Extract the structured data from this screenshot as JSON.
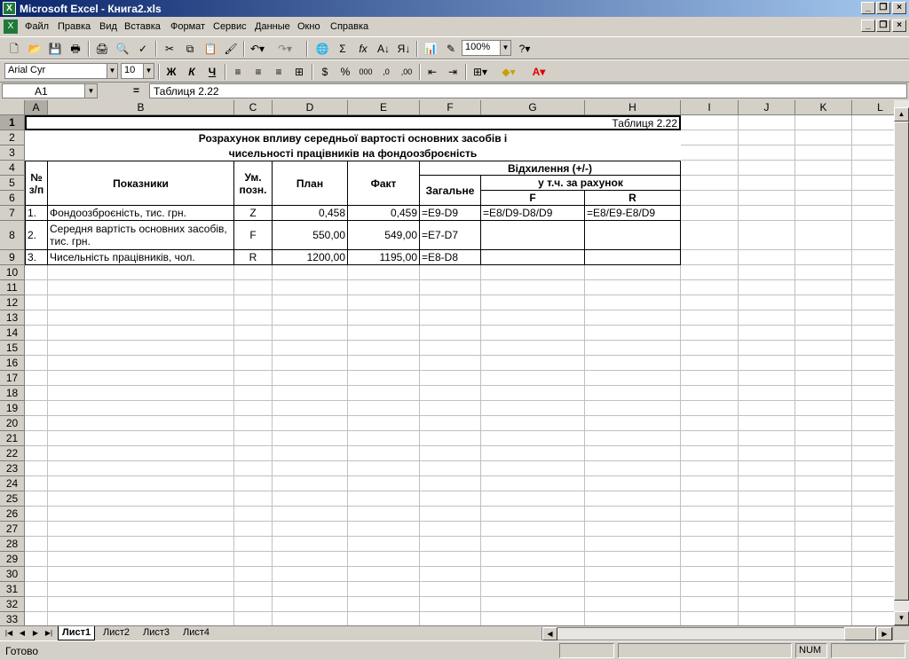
{
  "window": {
    "title": "Microsoft Excel - Книга2.xls"
  },
  "menu": [
    "Файл",
    "Правка",
    "Вид",
    "Вставка",
    "Формат",
    "Сервис",
    "Данные",
    "Окно",
    "Справка"
  ],
  "toolbar": {
    "zoom": "100%",
    "font": "Arial Cyr",
    "size": "10"
  },
  "formula_bar": {
    "cell_ref": "A1",
    "equals": "=",
    "content": "Таблиця 2.22"
  },
  "columns": [
    "A",
    "B",
    "C",
    "D",
    "E",
    "F",
    "G",
    "H",
    "I",
    "J",
    "K",
    "L"
  ],
  "rows": [
    "1",
    "2",
    "3",
    "4",
    "5",
    "6",
    "7",
    "8",
    "9",
    "10",
    "11",
    "12",
    "13",
    "14",
    "15",
    "16",
    "17",
    "18",
    "19",
    "20",
    "21",
    "22",
    "23",
    "24",
    "25",
    "26",
    "27",
    "28",
    "29",
    "30",
    "31",
    "32",
    "33"
  ],
  "table": {
    "caption": "Таблиця 2.22",
    "title1": "Розрахунок впливу середньої вартості основних засобів і",
    "title2": "чисельності працівників на фондоозброєність",
    "h_no": "№ з/п",
    "h_indicator": "Показники",
    "h_symbol": "Ум. позн.",
    "h_plan": "План",
    "h_fact": "Факт",
    "h_deviation": "Відхилення (+/-)",
    "h_total": "Загальне",
    "h_incl": "у т.ч. за рахунок",
    "h_f": "F",
    "h_r": "R",
    "rows": [
      {
        "no": "1.",
        "name": "Фондоозброєність, тис. грн.",
        "sym": "Z",
        "plan": "0,458",
        "fact": "0,459",
        "total": "=E9-D9",
        "f": "=E8/D9-D8/D9",
        "r": "=E8/E9-E8/D9"
      },
      {
        "no": "2.",
        "name": "Середня вартість основних засобів, тис. грн.",
        "sym": "F",
        "plan": "550,00",
        "fact": "549,00",
        "total": "=E7-D7",
        "f": "",
        "r": ""
      },
      {
        "no": "3.",
        "name": "Чисельність працівників, чол.",
        "sym": "R",
        "plan": "1200,00",
        "fact": "1195,00",
        "total": "=E8-D8",
        "f": "",
        "r": ""
      }
    ]
  },
  "sheet_tabs": [
    "Лист1",
    "Лист2",
    "Лист3",
    "Лист4"
  ],
  "status": {
    "text": "Готово",
    "num": "NUM"
  }
}
